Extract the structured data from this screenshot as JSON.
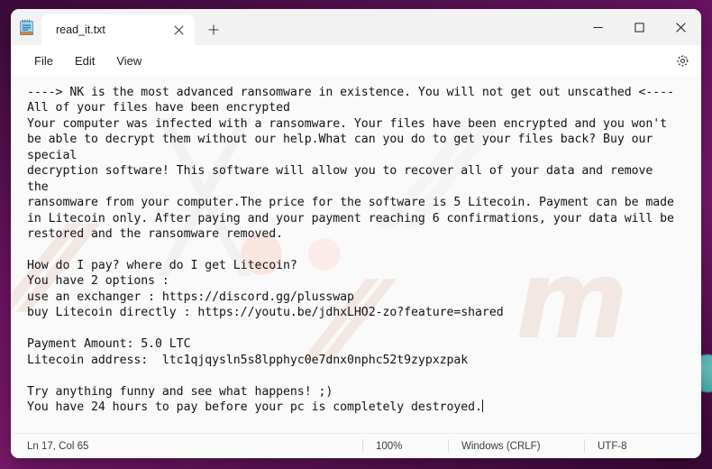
{
  "desktop": {
    "background_color": "#6b1463",
    "accent_orb_color": "#3fc9c0"
  },
  "window": {
    "app_icon": "notepad-icon",
    "tab": {
      "title": "read_it.txt",
      "close_icon": "close-icon"
    },
    "new_tab": {
      "icon": "plus-icon",
      "label": "+"
    },
    "controls": {
      "minimize": "—",
      "maximize": "□",
      "close": "✕"
    }
  },
  "menubar": {
    "items": [
      {
        "label": "File",
        "name": "menu-file"
      },
      {
        "label": "Edit",
        "name": "menu-edit"
      },
      {
        "label": "View",
        "name": "menu-view"
      }
    ],
    "settings_icon": "gear-icon"
  },
  "editor": {
    "content": "----> NK is the most advanced ransomware in existence. You will not get out unscathed <----\nAll of your files have been encrypted\nYour computer was infected with a ransomware. Your files have been encrypted and you won't\nbe able to decrypt them without our help.What can you do to get your files back? Buy our\nspecial\ndecryption software! This software will allow you to recover all of your data and remove\nthe\nransomware from your computer.The price for the software is 5 Litecoin. Payment can be made\nin Litecoin only. After paying and your payment reaching 6 confirmations, your data will be\nrestored and the ransomware removed.\n\nHow do I pay? where do I get Litecoin?\nYou have 2 options :\nuse an exchanger : https://discord.gg/plusswap\nbuy Litecoin directly : https://youtu.be/jdhxLHO2-zo?feature=shared\n\nPayment Amount: 5.0 LTC\nLitecoin address:  ltc1qjqysln5s8lpphyc0e7dnx0nphc52t9zypxzpak\n\nTry anything funny and see what happens! ;)\nYou have 24 hours to pay before your pc is completely destroyed.",
    "ransom_details": {
      "ransomware_name": "NK",
      "price": "5 Litecoin",
      "payment_amount": "5.0 LTC",
      "confirmations_required": "6",
      "deadline": "24 hours",
      "exchanger_url": "https://discord.gg/plusswap",
      "buy_litecoin_url": "https://youtu.be/jdhxLHO2-zo?feature=shared",
      "litecoin_address": "ltc1qjqysln5s8lpphyc0e7dnx0nphc52t9zypxzpak"
    }
  },
  "statusbar": {
    "cursor": "Ln 17, Col 65",
    "zoom": "100%",
    "line_ending": "Windows (CRLF)",
    "encoding": "UTF-8"
  }
}
